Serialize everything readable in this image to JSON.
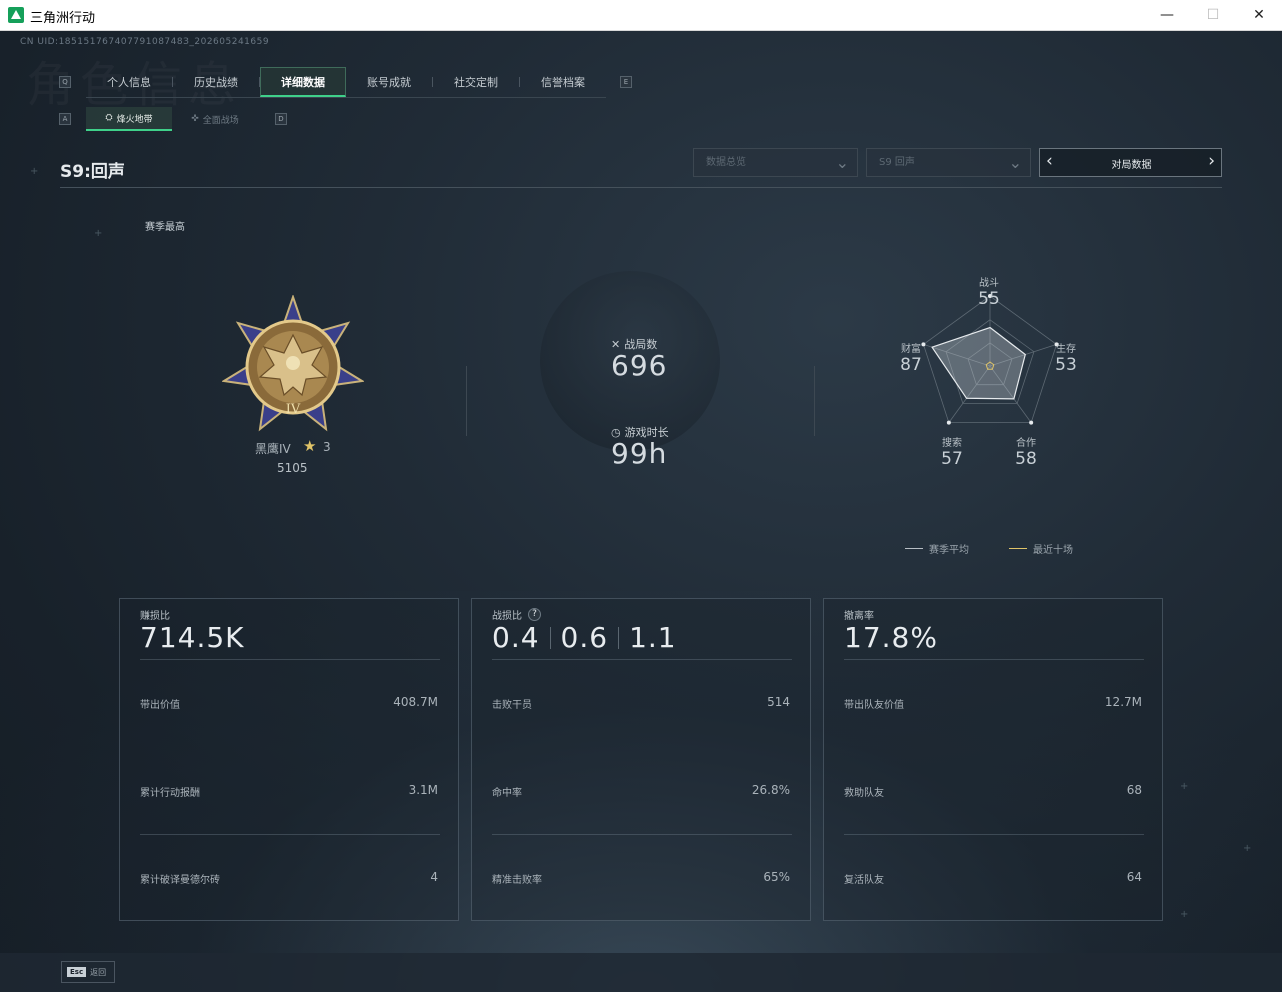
{
  "window": {
    "title": "三角洲行动",
    "minimize": "—",
    "maximize": "☐",
    "close": "✕"
  },
  "uid": "CN UID:18515176740779108748З_202605241659",
  "background_word": "角色信息",
  "nav": {
    "left_key": "Q",
    "right_key": "E",
    "tabs": [
      {
        "label": "个人信息",
        "active": false
      },
      {
        "label": "历史战绩",
        "active": false
      },
      {
        "label": "详细数据",
        "active": true
      },
      {
        "label": "账号成就",
        "active": false
      },
      {
        "label": "社交定制",
        "active": false
      },
      {
        "label": "信誉档案",
        "active": false
      }
    ]
  },
  "subnav": {
    "left_key": "A",
    "right_key": "D",
    "tabs": [
      {
        "label": "烽火地带",
        "icon": "⛭",
        "active": true
      },
      {
        "label": "全面战场",
        "icon": "✜",
        "active": false
      }
    ]
  },
  "season": {
    "title": "S9:回声",
    "dropdown_1": "数据总览",
    "dropdown_2": "S9 回声",
    "pager_label": "对局数据",
    "best_label": "赛季最高"
  },
  "rank": {
    "name": "黑鹰IV",
    "stars": "3",
    "score": "5105",
    "emblem_numeral": "IV"
  },
  "stats": {
    "matches_label": "战局数",
    "matches_value": "696",
    "time_label": "游戏时长",
    "time_value": "99h"
  },
  "radar": {
    "axes": [
      {
        "label": "战斗",
        "value": "55"
      },
      {
        "label": "生存",
        "value": "53"
      },
      {
        "label": "合作",
        "value": "58"
      },
      {
        "label": "搜索",
        "value": "57"
      },
      {
        "label": "财富",
        "value": "87"
      }
    ],
    "season_avg_color": "#b7bec4",
    "recent_color": "#e0c468"
  },
  "legend": {
    "season_avg": "赛季平均",
    "recent_ten": "最近十场"
  },
  "cards": [
    {
      "top_label": "赚损比",
      "big": [
        "714.5K"
      ],
      "rows": [
        {
          "label": "带出价值",
          "value": "408.7M"
        },
        {
          "label": "累计行动报酬",
          "value": "3.1M"
        },
        {
          "label": "累计破译曼德尔砖",
          "value": "4"
        }
      ]
    },
    {
      "top_label": "战损比",
      "help": "?",
      "big": [
        "0.4",
        "0.6",
        "1.1"
      ],
      "rows": [
        {
          "label": "击败干员",
          "value": "514"
        },
        {
          "label": "命中率",
          "value": "26.8%"
        },
        {
          "label": "精准击败率",
          "value": "65%"
        }
      ]
    },
    {
      "top_label": "撤离率",
      "big": [
        "17.8%"
      ],
      "rows": [
        {
          "label": "带出队友价值",
          "value": "12.7M"
        },
        {
          "label": "救助队友",
          "value": "68"
        },
        {
          "label": "复活队友",
          "value": "64"
        }
      ]
    }
  ],
  "footer": {
    "esc_key": "Esc",
    "esc_label": "返回"
  },
  "colors": {
    "accent": "#3fd18a",
    "gold": "#e0c468"
  }
}
